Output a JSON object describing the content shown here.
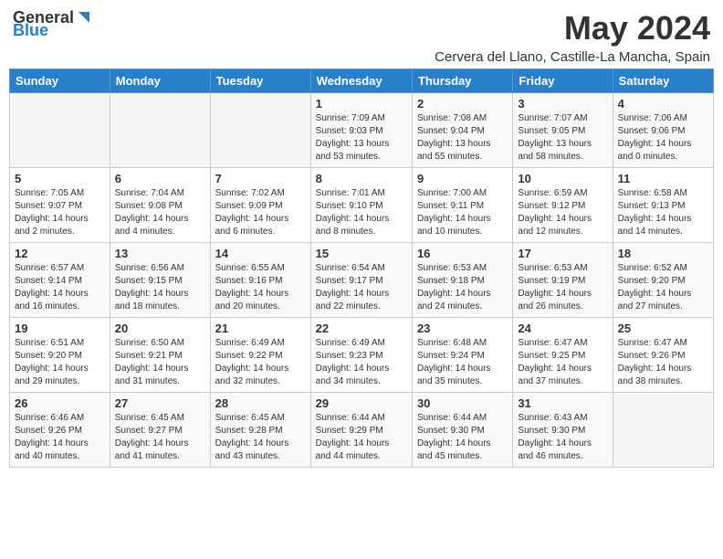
{
  "header": {
    "logo_general": "General",
    "logo_blue": "Blue",
    "month_year": "May 2024",
    "location": "Cervera del Llano, Castille-La Mancha, Spain"
  },
  "days_of_week": [
    "Sunday",
    "Monday",
    "Tuesday",
    "Wednesday",
    "Thursday",
    "Friday",
    "Saturday"
  ],
  "weeks": [
    [
      {
        "day": "",
        "info": ""
      },
      {
        "day": "",
        "info": ""
      },
      {
        "day": "",
        "info": ""
      },
      {
        "day": "1",
        "info": "Sunrise: 7:09 AM\nSunset: 9:03 PM\nDaylight: 13 hours\nand 53 minutes."
      },
      {
        "day": "2",
        "info": "Sunrise: 7:08 AM\nSunset: 9:04 PM\nDaylight: 13 hours\nand 55 minutes."
      },
      {
        "day": "3",
        "info": "Sunrise: 7:07 AM\nSunset: 9:05 PM\nDaylight: 13 hours\nand 58 minutes."
      },
      {
        "day": "4",
        "info": "Sunrise: 7:06 AM\nSunset: 9:06 PM\nDaylight: 14 hours\nand 0 minutes."
      }
    ],
    [
      {
        "day": "5",
        "info": "Sunrise: 7:05 AM\nSunset: 9:07 PM\nDaylight: 14 hours\nand 2 minutes."
      },
      {
        "day": "6",
        "info": "Sunrise: 7:04 AM\nSunset: 9:08 PM\nDaylight: 14 hours\nand 4 minutes."
      },
      {
        "day": "7",
        "info": "Sunrise: 7:02 AM\nSunset: 9:09 PM\nDaylight: 14 hours\nand 6 minutes."
      },
      {
        "day": "8",
        "info": "Sunrise: 7:01 AM\nSunset: 9:10 PM\nDaylight: 14 hours\nand 8 minutes."
      },
      {
        "day": "9",
        "info": "Sunrise: 7:00 AM\nSunset: 9:11 PM\nDaylight: 14 hours\nand 10 minutes."
      },
      {
        "day": "10",
        "info": "Sunrise: 6:59 AM\nSunset: 9:12 PM\nDaylight: 14 hours\nand 12 minutes."
      },
      {
        "day": "11",
        "info": "Sunrise: 6:58 AM\nSunset: 9:13 PM\nDaylight: 14 hours\nand 14 minutes."
      }
    ],
    [
      {
        "day": "12",
        "info": "Sunrise: 6:57 AM\nSunset: 9:14 PM\nDaylight: 14 hours\nand 16 minutes."
      },
      {
        "day": "13",
        "info": "Sunrise: 6:56 AM\nSunset: 9:15 PM\nDaylight: 14 hours\nand 18 minutes."
      },
      {
        "day": "14",
        "info": "Sunrise: 6:55 AM\nSunset: 9:16 PM\nDaylight: 14 hours\nand 20 minutes."
      },
      {
        "day": "15",
        "info": "Sunrise: 6:54 AM\nSunset: 9:17 PM\nDaylight: 14 hours\nand 22 minutes."
      },
      {
        "day": "16",
        "info": "Sunrise: 6:53 AM\nSunset: 9:18 PM\nDaylight: 14 hours\nand 24 minutes."
      },
      {
        "day": "17",
        "info": "Sunrise: 6:53 AM\nSunset: 9:19 PM\nDaylight: 14 hours\nand 26 minutes."
      },
      {
        "day": "18",
        "info": "Sunrise: 6:52 AM\nSunset: 9:20 PM\nDaylight: 14 hours\nand 27 minutes."
      }
    ],
    [
      {
        "day": "19",
        "info": "Sunrise: 6:51 AM\nSunset: 9:20 PM\nDaylight: 14 hours\nand 29 minutes."
      },
      {
        "day": "20",
        "info": "Sunrise: 6:50 AM\nSunset: 9:21 PM\nDaylight: 14 hours\nand 31 minutes."
      },
      {
        "day": "21",
        "info": "Sunrise: 6:49 AM\nSunset: 9:22 PM\nDaylight: 14 hours\nand 32 minutes."
      },
      {
        "day": "22",
        "info": "Sunrise: 6:49 AM\nSunset: 9:23 PM\nDaylight: 14 hours\nand 34 minutes."
      },
      {
        "day": "23",
        "info": "Sunrise: 6:48 AM\nSunset: 9:24 PM\nDaylight: 14 hours\nand 35 minutes."
      },
      {
        "day": "24",
        "info": "Sunrise: 6:47 AM\nSunset: 9:25 PM\nDaylight: 14 hours\nand 37 minutes."
      },
      {
        "day": "25",
        "info": "Sunrise: 6:47 AM\nSunset: 9:26 PM\nDaylight: 14 hours\nand 38 minutes."
      }
    ],
    [
      {
        "day": "26",
        "info": "Sunrise: 6:46 AM\nSunset: 9:26 PM\nDaylight: 14 hours\nand 40 minutes."
      },
      {
        "day": "27",
        "info": "Sunrise: 6:45 AM\nSunset: 9:27 PM\nDaylight: 14 hours\nand 41 minutes."
      },
      {
        "day": "28",
        "info": "Sunrise: 6:45 AM\nSunset: 9:28 PM\nDaylight: 14 hours\nand 43 minutes."
      },
      {
        "day": "29",
        "info": "Sunrise: 6:44 AM\nSunset: 9:29 PM\nDaylight: 14 hours\nand 44 minutes."
      },
      {
        "day": "30",
        "info": "Sunrise: 6:44 AM\nSunset: 9:30 PM\nDaylight: 14 hours\nand 45 minutes."
      },
      {
        "day": "31",
        "info": "Sunrise: 6:43 AM\nSunset: 9:30 PM\nDaylight: 14 hours\nand 46 minutes."
      },
      {
        "day": "",
        "info": ""
      }
    ]
  ]
}
